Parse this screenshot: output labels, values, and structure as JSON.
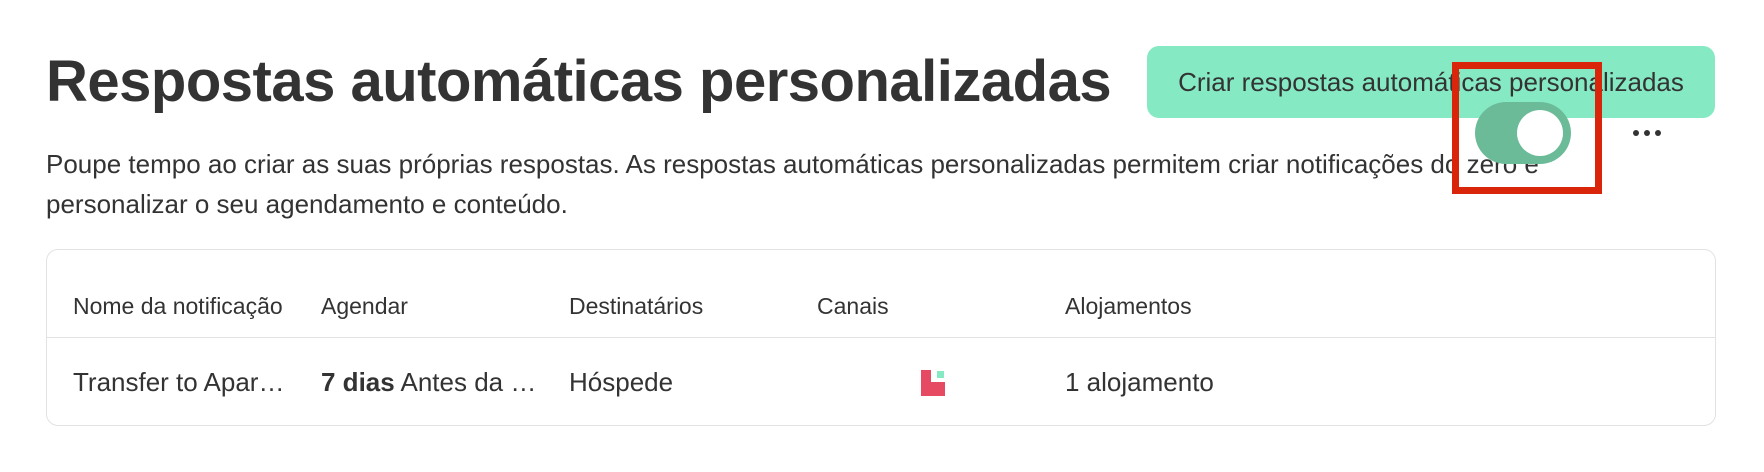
{
  "header": {
    "title": "Respostas automáticas personalizadas",
    "create_button_label": "Criar respostas automáticas personalizadas"
  },
  "description": "Poupe tempo ao criar as suas próprias respostas. As respostas automáticas personalizadas permitem criar notificações do zero e personalizar o seu agendamento e conteúdo.",
  "table": {
    "columns": [
      "Nome da notificação",
      "Agendar",
      "Destinatários",
      "Canais",
      "Alojamentos"
    ],
    "rows": [
      {
        "name": "Transfer to Apar…",
        "schedule_bold": "7 dias",
        "schedule_rest": " Antes da …",
        "recipients": "Hóspede",
        "channel_icon": "channel-app-icon",
        "properties": "1 alojamento",
        "enabled": true,
        "more_icon": "more-options-icon"
      }
    ]
  },
  "colors": {
    "accent_button": "#85eac4",
    "toggle_on": "#6cbb98",
    "channel_icon_primary": "#e54a62",
    "channel_icon_secondary": "#85eac4",
    "highlight_box": "#d9260b",
    "text": "#333333"
  }
}
